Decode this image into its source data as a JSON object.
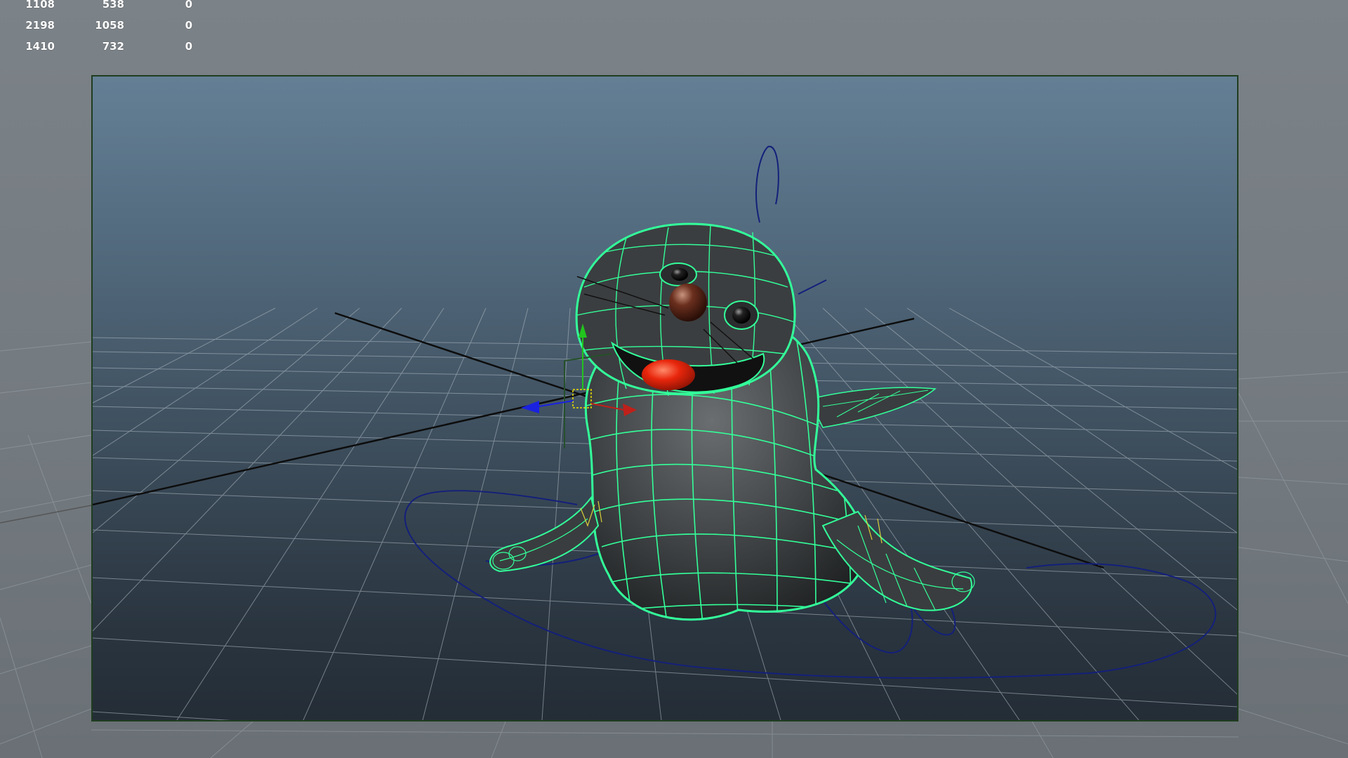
{
  "hud": {
    "rows": [
      [
        "1108",
        "538",
        "0"
      ],
      [
        "2198",
        "1058",
        "0"
      ],
      [
        "1410",
        "732",
        "0"
      ]
    ]
  },
  "viewport": {
    "content": "seal character rig with green wireframe on shaded mesh",
    "colors": {
      "wireframe": "#33ff9a",
      "control_curves": "#14207a",
      "grid_lines": "#9aa6b0",
      "axis_lines": "#101010",
      "frame_border": "#1f3d1f",
      "body": "#3c3f40",
      "tongue": "#e8260c",
      "nose": "#5a2a1a"
    },
    "icons": [
      "x-axis-manipulator-icon",
      "y-axis-manipulator-icon",
      "z-axis-manipulator-icon",
      "pivot-icon"
    ]
  }
}
